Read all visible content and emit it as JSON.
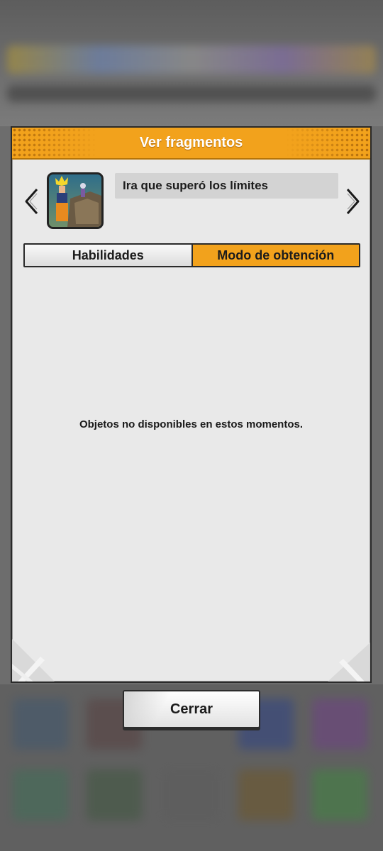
{
  "modal": {
    "title": "Ver fragmentos",
    "item_name": "Ira que superó los límites",
    "tabs": [
      {
        "label": "Habilidades",
        "active": false
      },
      {
        "label": "Modo de obtención",
        "active": true
      }
    ],
    "empty_message": "Objetos no disponibles en estos momentos.",
    "close_label": "Cerrar"
  },
  "colors": {
    "accent": "#f2a21c",
    "panel": "#e9e9e9",
    "border": "#2a2a2a"
  },
  "icons": [
    "chevron-left-icon",
    "chevron-right-icon",
    "character-thumbnail"
  ]
}
